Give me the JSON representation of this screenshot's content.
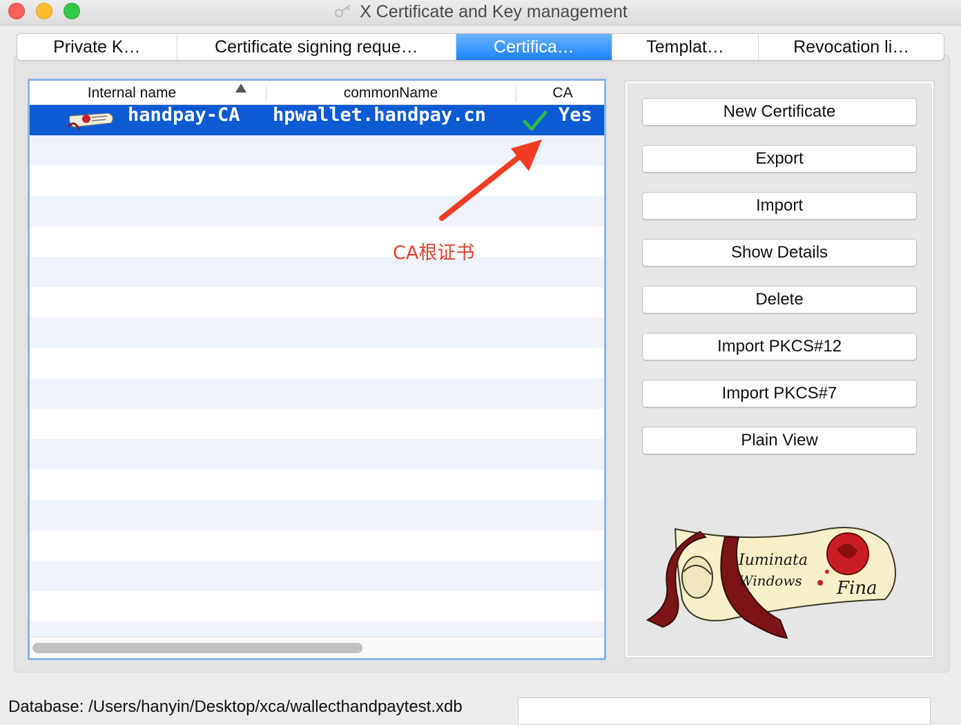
{
  "window": {
    "title": "X Certificate and Key management"
  },
  "tabs": [
    {
      "label": "Private K…",
      "active": false
    },
    {
      "label": "Certificate signing reque…",
      "active": false
    },
    {
      "label": "Certifica…",
      "active": true
    },
    {
      "label": "Templat…",
      "active": false
    },
    {
      "label": "Revocation li…",
      "active": false
    }
  ],
  "list": {
    "columns": [
      "Internal name",
      "commonName",
      "CA"
    ],
    "sort": {
      "column": "Internal name",
      "direction": "ascending"
    },
    "rows": [
      {
        "internal_name": "handpay-CA",
        "common_name": "hpwallet.handpay.cn",
        "ca": "Yes",
        "icon": "certificate-icon",
        "ca_mark": "checkmark-icon",
        "selected": true
      }
    ]
  },
  "annotation": {
    "text": "CA根证书",
    "color": "#e8412e"
  },
  "buttons": [
    {
      "label": "New Certificate"
    },
    {
      "label": "Export"
    },
    {
      "label": "Import"
    },
    {
      "label": "Show Details"
    },
    {
      "label": "Delete"
    },
    {
      "label": "Import PKCS#12"
    },
    {
      "label": "Import PKCS#7"
    },
    {
      "label": "Plain View"
    }
  ],
  "logo": {
    "text_line1": "Iuminata",
    "text_line2": "Windows",
    "text_line3": "Fina"
  },
  "status": {
    "database": "Database: /Users/hanyin/Desktop/xca/wallecthandpaytest.xdb"
  },
  "colors": {
    "selection": "#0c5bd3",
    "tab_active": "#1a82fb",
    "list_border": "#8ab4ea",
    "annotation": "#e8412e"
  }
}
